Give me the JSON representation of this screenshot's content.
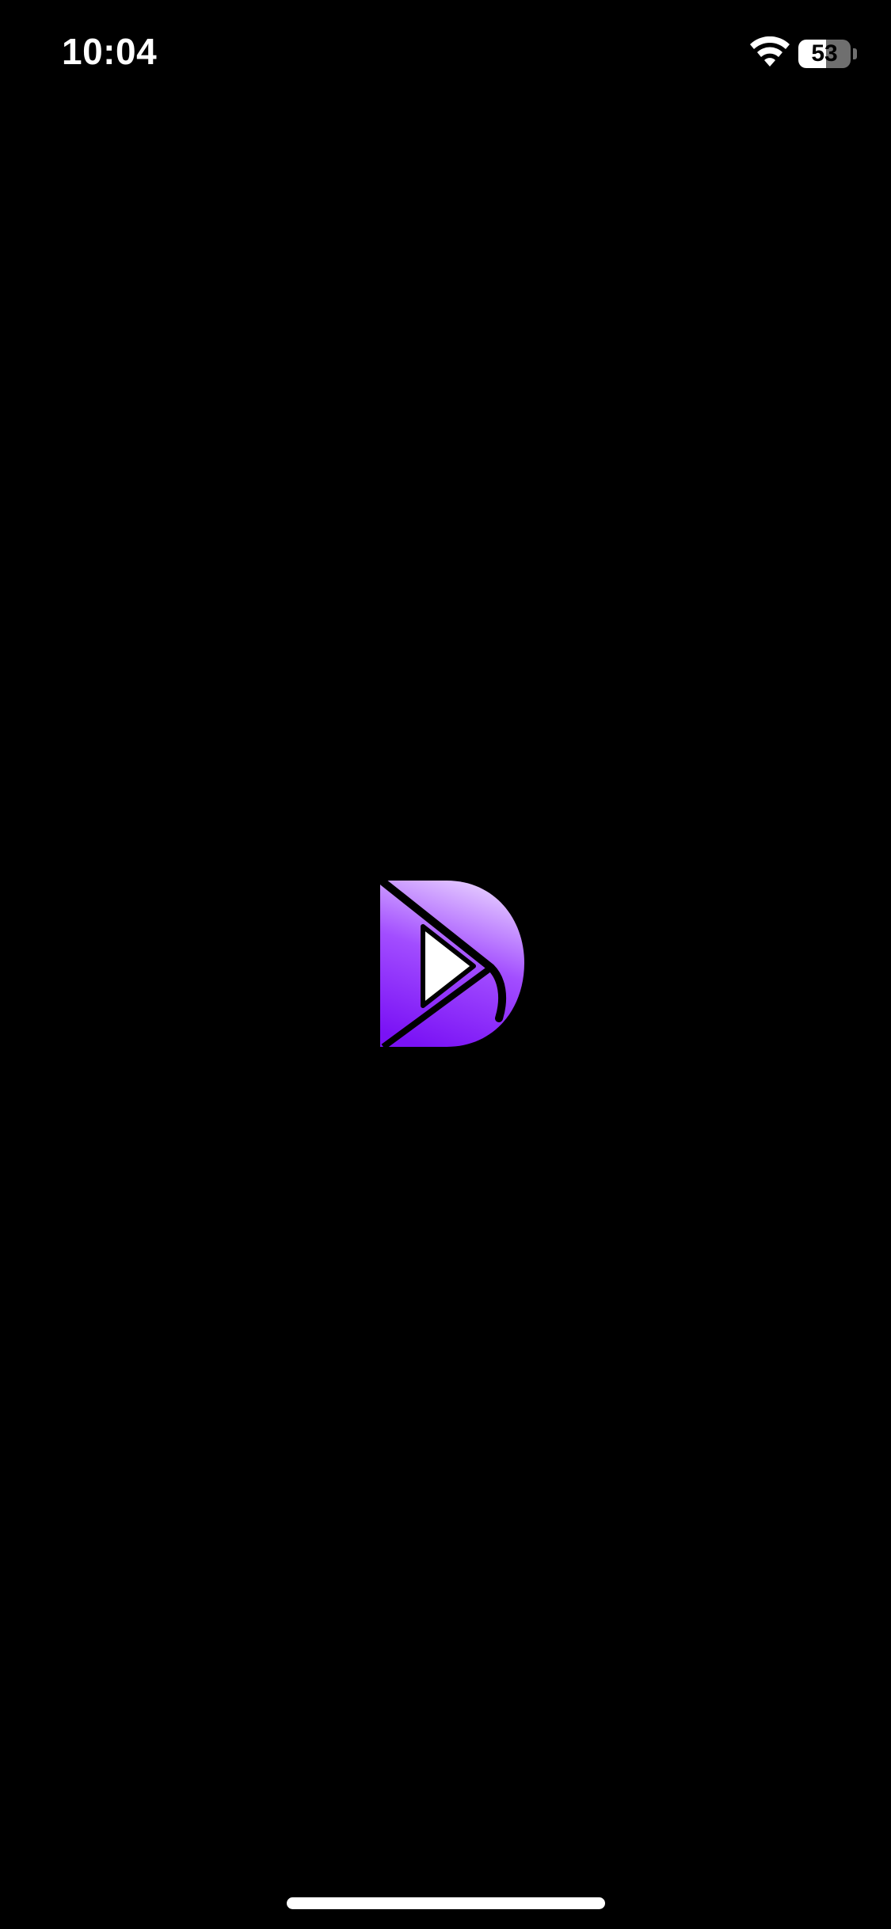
{
  "status_bar": {
    "time": "10:04",
    "battery_level": "53",
    "battery_fraction": 0.53
  },
  "icons": {
    "wifi": "wifi-icon",
    "battery": "battery-icon",
    "logo": "app-logo-play-d-icon"
  },
  "colors": {
    "background": "#000000",
    "logo_gradient_top": "#e2c6ff",
    "logo_gradient_mid": "#a24dff",
    "logo_gradient_bottom": "#7a12f5",
    "status_text": "#ffffff"
  }
}
